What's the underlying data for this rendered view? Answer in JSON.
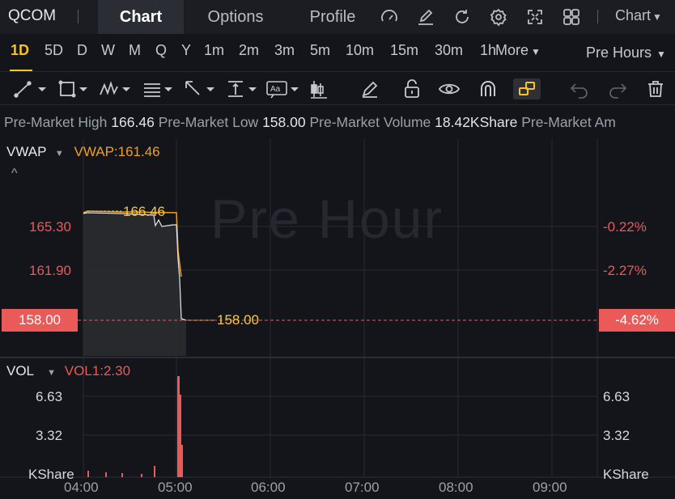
{
  "topbar": {
    "ticker": "QCOM",
    "tabs": [
      "Chart",
      "Options",
      "Profile"
    ],
    "active_tab": "Chart",
    "chart_selector": "Chart",
    "icons": [
      "gauge-icon",
      "edit-icon",
      "refresh-icon",
      "settings-icon",
      "fullscreen-icon",
      "grid-icon"
    ]
  },
  "periods": {
    "items": [
      "1D",
      "5D",
      "D",
      "W",
      "M",
      "Q",
      "Y",
      "1m",
      "2m",
      "3m",
      "5m",
      "10m",
      "15m",
      "30m",
      "1h",
      "More"
    ],
    "active": "1D",
    "session": "Pre Hours"
  },
  "toolbar": {
    "tools": [
      "line-tool-icon",
      "rectangle-tool-icon",
      "pattern-tool-icon",
      "fibonacci-tool-icon",
      "arrow-tool-icon",
      "measure-tool-icon",
      "text-tool-icon",
      "candle-tool-icon",
      "pen-icon",
      "unlock-icon",
      "eye-icon",
      "magnet-icon",
      "link-icon",
      "undo-icon",
      "redo-icon",
      "trash-icon"
    ],
    "active_tool": "link-icon"
  },
  "info": {
    "high_label": "Pre-Market High",
    "high_value": "166.46",
    "low_label": "Pre-Market Low",
    "low_value": "158.00",
    "volume_label": "Pre-Market Volume",
    "volume_value": "18.42KShare",
    "amount_label": "Pre-Market Am"
  },
  "price_pane": {
    "indicator": "VWAP",
    "indicator_value": "VWAP:161.46",
    "watermark": "Pre Hour",
    "left_axis": [
      "165.30",
      "161.90"
    ],
    "right_axis": [
      "-0.22%",
      "-2.27%"
    ],
    "current_price": "158.00",
    "current_change": "-4.62%",
    "high_marker": "166.46",
    "low_marker": "158.00"
  },
  "volume_pane": {
    "indicator": "VOL",
    "indicator_value": "VOL1:2.30",
    "axis": [
      "6.63",
      "3.32"
    ],
    "unit": "KShare"
  },
  "time_axis": [
    "04:00",
    "05:00",
    "06:00",
    "07:00",
    "08:00",
    "09:00"
  ],
  "colors": {
    "accent": "#f5c518",
    "down": "#ea5a58",
    "vwap": "#f0a020",
    "price_line": "#e8e8e8",
    "background": "#14151a"
  }
}
